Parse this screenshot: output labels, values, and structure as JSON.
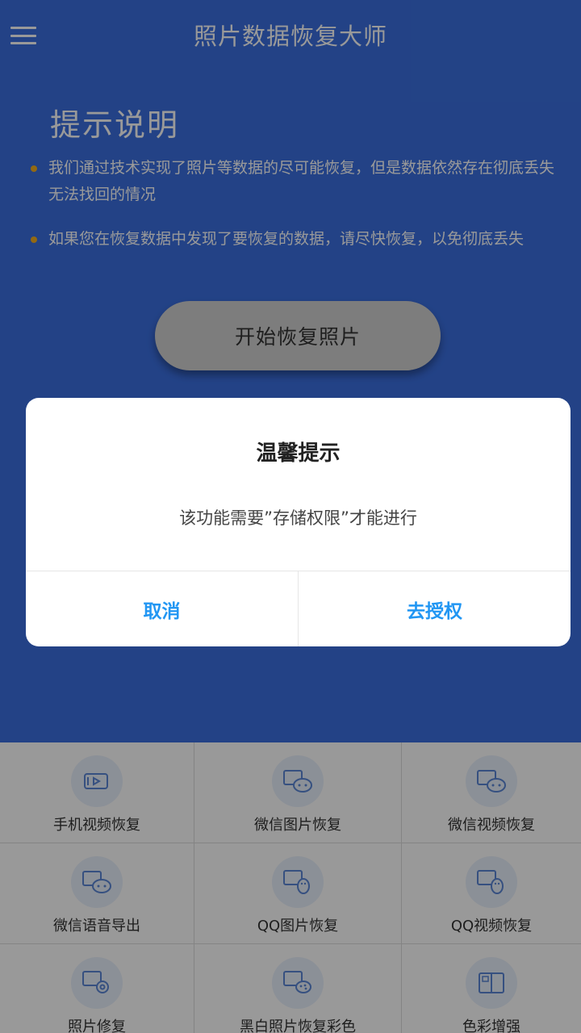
{
  "header": {
    "menu_icon": "hamburger-menu-icon",
    "title": "照片数据恢复大师"
  },
  "hint": {
    "title": "提示说明",
    "items": [
      "我们通过技术实现了照片等数据的尽可能恢复，但是数据依然存在彻底丢失无法找回的情况",
      "如果您在恢复数据中发现了要恢复的数据，请尽快恢复，以免彻底丢失"
    ]
  },
  "start_button": {
    "label": "开始恢复照片"
  },
  "features": [
    {
      "label": "手机视频恢复",
      "icon": "phone-video-icon"
    },
    {
      "label": "微信图片恢复",
      "icon": "wechat-image-icon"
    },
    {
      "label": "微信视频恢复",
      "icon": "wechat-video-icon"
    },
    {
      "label": "微信语音导出",
      "icon": "wechat-voice-icon"
    },
    {
      "label": "QQ图片恢复",
      "icon": "qq-image-icon"
    },
    {
      "label": "QQ视频恢复",
      "icon": "qq-video-icon"
    },
    {
      "label": "照片修复",
      "icon": "photo-repair-icon"
    },
    {
      "label": "黑白照片恢复彩色",
      "icon": "colorize-photo-icon"
    },
    {
      "label": "色彩增强",
      "icon": "color-enhance-icon"
    }
  ],
  "dialog": {
    "title": "温馨提示",
    "message": "该功能需要”存储权限”才能进行",
    "cancel_label": "取消",
    "confirm_label": "去授权"
  },
  "colors": {
    "header_bg": "#3b6fe0",
    "bullet": "#f5b01f",
    "dialog_button_text": "#2196f3",
    "icon_circle_bg": "#e8f0fc"
  }
}
